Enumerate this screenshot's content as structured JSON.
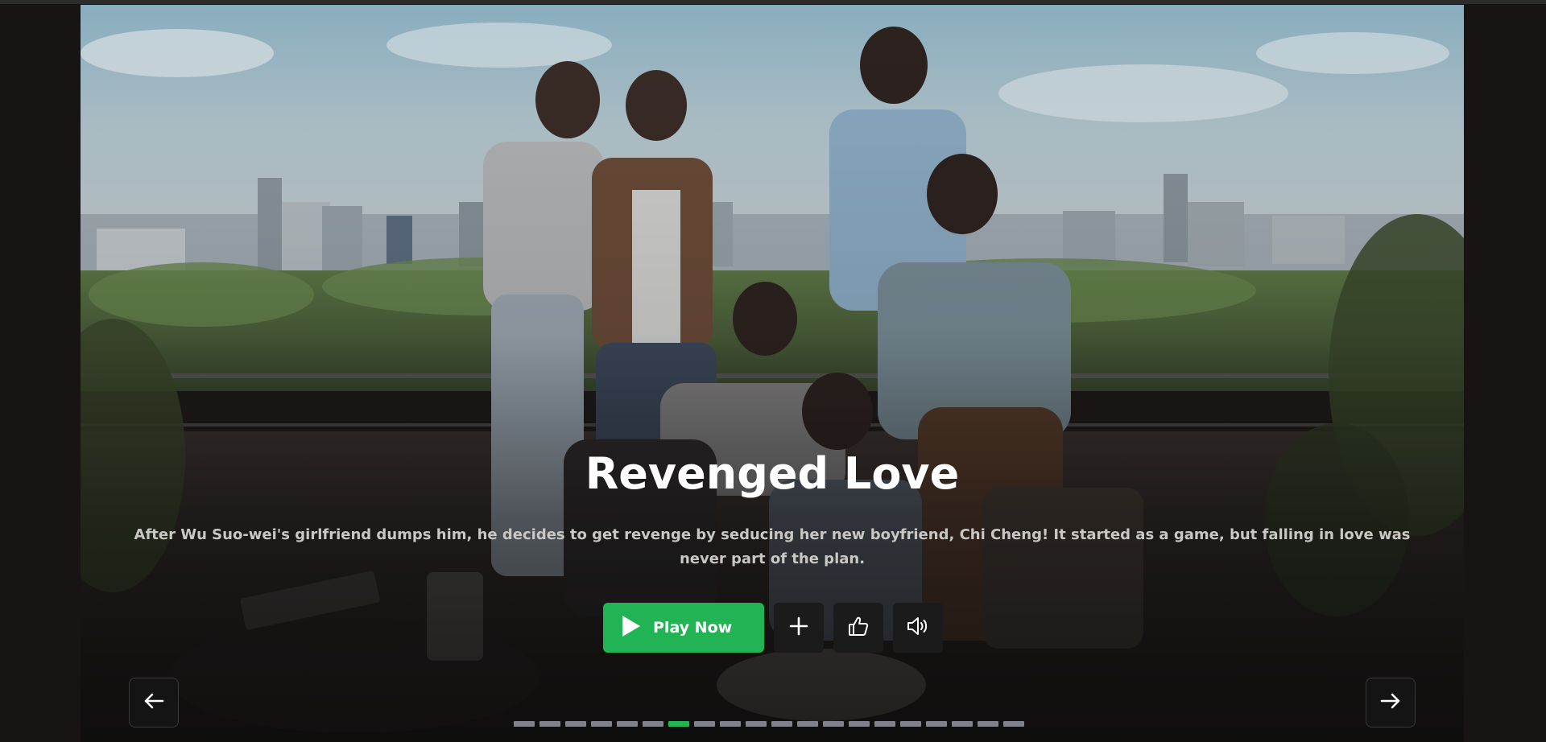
{
  "hero": {
    "title": "Revenged Love",
    "description": "After Wu Suo-wei's girlfriend dumps him, he decides to get revenge by seducing her new boyfriend, Chi Cheng! It started as a game, but falling in love was never part of the plan."
  },
  "actions": {
    "play_label": "Play Now",
    "play_icon": "play-icon",
    "add_icon": "plus-icon",
    "like_icon": "thumbs-up-icon",
    "sound_icon": "volume-icon"
  },
  "navigation": {
    "prev_icon": "arrow-left-icon",
    "next_icon": "arrow-right-icon"
  },
  "carousel": {
    "total_slides": 20,
    "active_index": 6
  },
  "colors": {
    "accent": "#22b454",
    "background": "#171413",
    "inactive_indicator": "#7f828a"
  }
}
